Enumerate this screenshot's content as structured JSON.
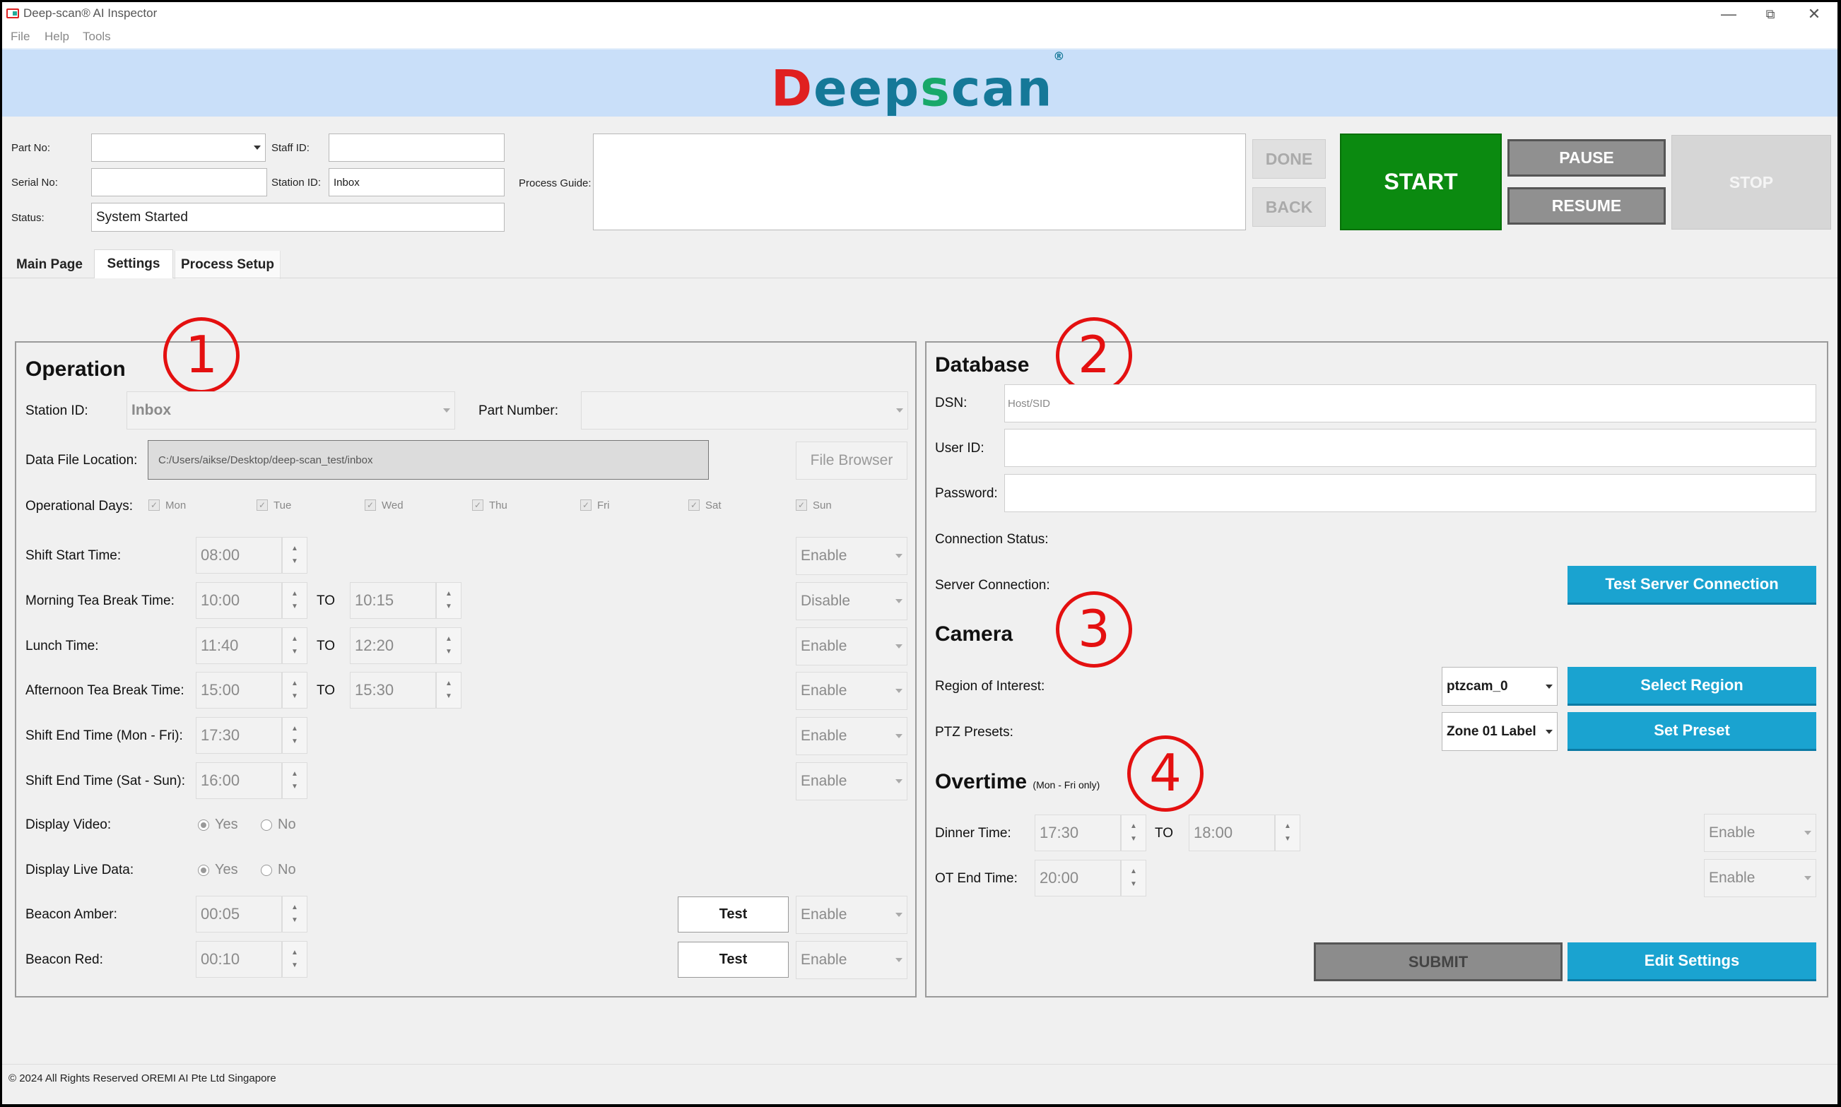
{
  "window": {
    "title": "Deep-scan® AI Inspector",
    "menu": [
      "File",
      "Help",
      "Tools"
    ]
  },
  "logo": {
    "d": "D",
    "eep": "eep",
    "s": "s",
    "can": "can",
    "mark": "®"
  },
  "header": {
    "part_no_label": "Part No:",
    "part_no_value": "",
    "staff_id_label": "Staff ID:",
    "staff_id_value": "",
    "serial_no_label": "Serial No:",
    "serial_no_value": "",
    "station_id_label": "Station ID:",
    "station_id_value": "Inbox",
    "status_label": "Status:",
    "status_value": "System Started",
    "process_guide_label": "Process Guide:",
    "process_guide_value": "",
    "done": "DONE",
    "back": "BACK",
    "start": "START",
    "pause": "PAUSE",
    "resume": "RESUME",
    "stop": "STOP"
  },
  "tabs": [
    "Main Page",
    "Settings",
    "Process Setup"
  ],
  "active_tab": "Settings",
  "annotations": [
    "1",
    "2",
    "3",
    "4"
  ],
  "operation": {
    "title": "Operation",
    "station_id_label": "Station ID:",
    "station_id_value": "Inbox",
    "part_number_label": "Part Number:",
    "part_number_value": "",
    "data_file_label": "Data File Location:",
    "data_file_value": "C:/Users/aikse/Desktop/deep-scan_test/inbox",
    "file_browser": "File Browser",
    "op_days_label": "Operational Days:",
    "days": [
      "Mon",
      "Tue",
      "Wed",
      "Thu",
      "Fri",
      "Sat",
      "Sun"
    ],
    "to": "TO",
    "rows": [
      {
        "label": "Shift Start Time:",
        "from": "08:00",
        "to": "",
        "state": "Enable"
      },
      {
        "label": "Morning Tea Break Time:",
        "from": "10:00",
        "to": "10:15",
        "state": "Disable"
      },
      {
        "label": "Lunch Time:",
        "from": "11:40",
        "to": "12:20",
        "state": "Enable"
      },
      {
        "label": "Afternoon Tea Break Time:",
        "from": "15:00",
        "to": "15:30",
        "state": "Enable"
      },
      {
        "label": "Shift End Time (Mon - Fri):",
        "from": "17:30",
        "to": "",
        "state": "Enable"
      },
      {
        "label": "Shift End Time (Sat - Sun):",
        "from": "16:00",
        "to": "",
        "state": "Enable"
      }
    ],
    "display_video_label": "Display Video:",
    "display_live_label": "Display Live Data:",
    "yes": "Yes",
    "no": "No",
    "beacon_amber_label": "Beacon Amber:",
    "beacon_amber_value": "00:05",
    "beacon_amber_state": "Enable",
    "beacon_red_label": "Beacon Red:",
    "beacon_red_value": "00:10",
    "beacon_red_state": "Enable",
    "test": "Test"
  },
  "database": {
    "title": "Database",
    "dsn_label": "DSN:",
    "dsn_placeholder": "Host/SID",
    "user_label": "User ID:",
    "password_label": "Password:",
    "conn_status_label": "Connection Status:",
    "server_conn_label": "Server Connection:",
    "test_server": "Test Server Connection"
  },
  "camera": {
    "title": "Camera",
    "roi_label": "Region of Interest:",
    "roi_value": "ptzcam_0",
    "select_region": "Select Region",
    "ptz_label": "PTZ Presets:",
    "ptz_value": "Zone 01 Label",
    "set_preset": "Set Preset"
  },
  "overtime": {
    "title": "Overtime",
    "note": "(Mon - Fri only)",
    "dinner_label": "Dinner Time:",
    "dinner_from": "17:30",
    "to": "TO",
    "dinner_to": "18:00",
    "dinner_state": "Enable",
    "ot_end_label": "OT End Time:",
    "ot_end_value": "20:00",
    "ot_end_state": "Enable"
  },
  "actions": {
    "submit": "SUBMIT",
    "edit": "Edit Settings"
  },
  "footer": "© 2024 All Rights Reserved OREMI AI Pte Ltd Singapore"
}
